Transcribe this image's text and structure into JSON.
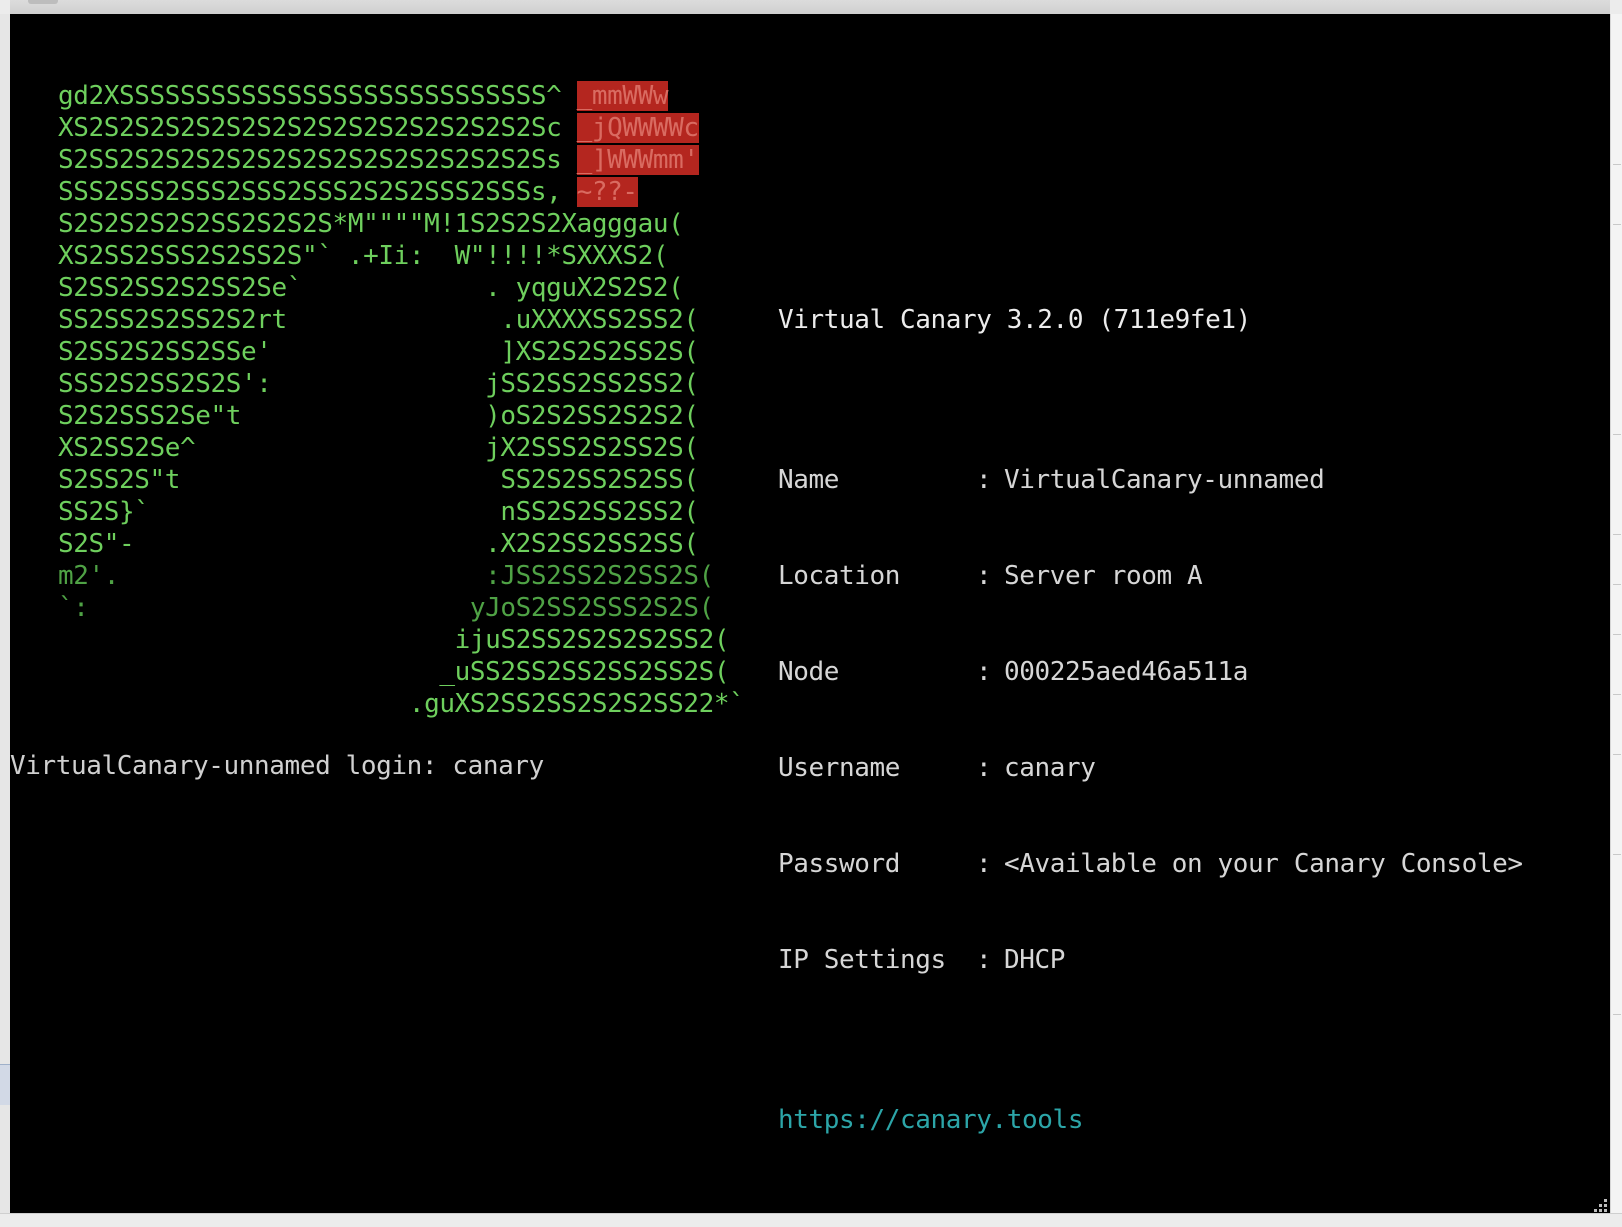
{
  "terminal": {
    "ascii_logo_lines": [
      "gd2XSSSSSSSSSSSSSSSSSSSSSSSSSSSS^ ",
      "XS2S2S2S2S2S2S2S2S2S2S2S2S2S2S2Sc ",
      "S2SS2S2S2S2S2S2S2S2S2S2S2S2S2S2Ss ",
      "SSS2SSS2SSS2SSS2SSS2S2S2SSS2SSSs, ",
      "S2S2S2S2S2SS2S2S2S*M\"\"\"\"M!1S2S2S2Xagggau(",
      "XS2SS2SSS2S2SS2S\"` .+Ii:  W\"!!!!*SXXXS2(",
      "S2SS2SS2S2SS2Se`            . yqguX2S2S2(",
      "SS2SS2S2SS2S2rt              .uXXXXSS2SS2(",
      "S2SS2S2SS2SSe'               ]XS2S2S2SS2S(",
      "SSS2S2SS2S2S':              jSS2SS2SS2SS2(",
      "S2S2SSS2Se\"t                )oS2S2SS2S2S2(",
      "XS2SS2Se^                   jX2SSS2S2SS2S(",
      "S2SS2S\"t                     SS2S2SS2S2SS(",
      "SS2S}`                       nSS2S2SS2SS2(",
      "S2S\"-                       .X2S2SS2SS2SS(",
      "m2'.                        :JSS2SS2S2SS2S(",
      "`:                         yJoS2SS2SSS2S2S(",
      "                          ijuS2SS2S2S2S2SS2(",
      "                         _uSS2SS2SS2SS2SS2S(",
      "                       .guXS2SS2SS2S2S2SS22*`"
    ],
    "ascii_logo_red": [
      "_mmWWw",
      "_jQWWWWc",
      "_]WWWmm'",
      "~??-"
    ],
    "version_line": "Virtual Canary 3.2.0 (711e9fe1)",
    "info_rows": [
      {
        "label": "Name",
        "value": "VirtualCanary-unnamed"
      },
      {
        "label": "Location",
        "value": "Server room A"
      },
      {
        "label": "Node",
        "value": "000225aed46a511a"
      },
      {
        "label": "Username",
        "value": "canary"
      },
      {
        "label": "Password",
        "value": "<Available on your Canary Console>"
      },
      {
        "label": "IP Settings",
        "value": "DHCP"
      }
    ],
    "separator": ":",
    "link": "https://canary.tools",
    "login_prompt": "VirtualCanary-unnamed login: canary"
  },
  "colors": {
    "background": "#000000",
    "logo_green": "#6ecf5d",
    "logo_red": "#b4261f",
    "text": "#d6d6d6",
    "link": "#2ca5a8"
  }
}
